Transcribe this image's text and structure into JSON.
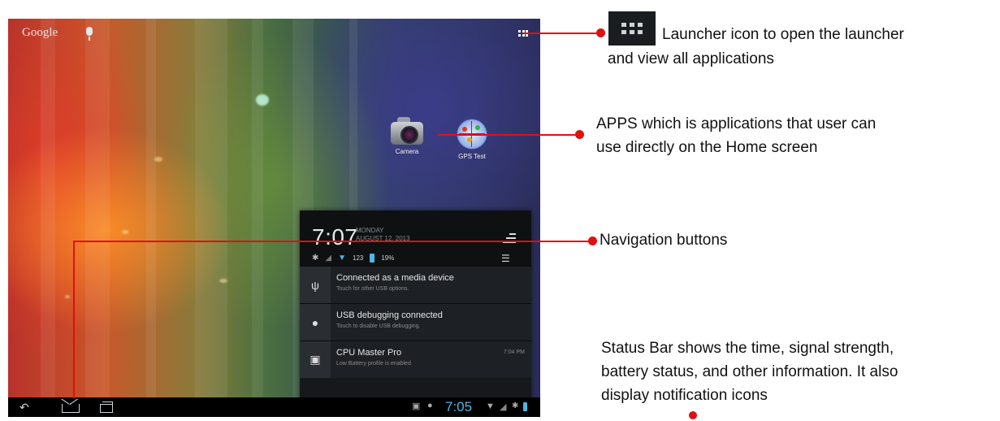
{
  "home_screen": {
    "search_label": "Google",
    "icons": {
      "mic": "mic-icon",
      "launcher": "app-grid-icon"
    },
    "apps": [
      {
        "label": "Camera",
        "icon": "camera-icon"
      },
      {
        "label": "GPS Test",
        "icon": "gps-icon"
      }
    ]
  },
  "notification_panel": {
    "time": "7:07",
    "day": "MONDAY",
    "date": "AUGUST 12, 2013",
    "wifi_label": "123",
    "battery_percent": "19%",
    "notifications": [
      {
        "title": "Connected as a media device",
        "subtitle": "Touch for other USB options.",
        "time": "",
        "icon": "usb-icon"
      },
      {
        "title": "USB debugging connected",
        "subtitle": "Touch to disable USB debugging.",
        "time": "",
        "icon": "android-icon"
      },
      {
        "title": "CPU Master Pro",
        "subtitle": "Low Battery profile is enabled",
        "time": "7:04 PM",
        "icon": "cpu-icon"
      }
    ]
  },
  "nav_bar": {
    "buttons": [
      "back-icon",
      "home-icon",
      "recent-apps-icon"
    ],
    "status_time": "7:05"
  },
  "annotations": {
    "launcher": {
      "line1": "Launcher icon to open the launcher",
      "line2": "and view all applications"
    },
    "apps": {
      "line1": "APPS  which  is applications that user can",
      "line2": "use directly on the Home screen"
    },
    "navigation": {
      "line1": "Navigation buttons"
    },
    "status_bar": {
      "line1": "Status Bar shows the time, signal strength,",
      "line2": "battery status, and other information. It also",
      "line3": "display notification icons"
    }
  },
  "colors": {
    "callout_red": "#e01010",
    "accent_blue": "#4db6e6"
  }
}
